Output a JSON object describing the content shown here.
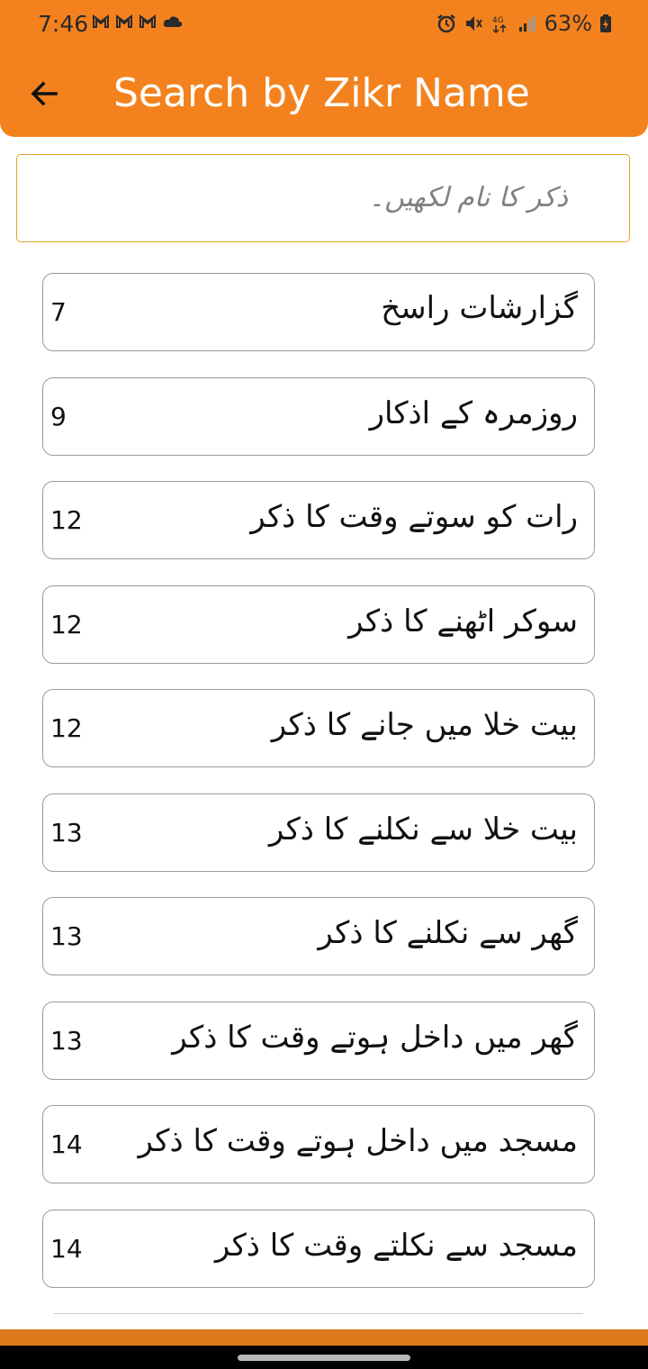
{
  "status": {
    "time": "7:46",
    "battery": "63%",
    "icons": [
      "gmail-icon",
      "gmail-icon",
      "gmail-icon",
      "cloud-icon",
      "alarm-icon",
      "vibrate-icon",
      "4g-icon",
      "signal-icon",
      "battery-icon"
    ]
  },
  "header": {
    "title": "Search by Zikr Name",
    "background_color": "#F3821E"
  },
  "search": {
    "placeholder": "ذکر کا نام لکھیں۔",
    "value": ""
  },
  "items": [
    {
      "title": "گزارشات راسخ",
      "page": "7"
    },
    {
      "title": "روزمرہ کے اذکار",
      "page": "9"
    },
    {
      "title": "رات کو سوتے وقت کا ذکر",
      "page": "12"
    },
    {
      "title": "سوکر اٹھنے کا ذکر",
      "page": "12"
    },
    {
      "title": "بیت خلا میں جانے کا ذکر",
      "page": "12"
    },
    {
      "title": "بیت خلا سے نکلنے کا ذکر",
      "page": "13"
    },
    {
      "title": "گھر سے نکلنے کا ذکر",
      "page": "13"
    },
    {
      "title": "گھر میں داخل ہوتے وقت کا ذکر",
      "page": "13"
    },
    {
      "title": "مسجد میں داخل ہوتے وقت کا ذکر",
      "page": "14"
    },
    {
      "title": "مسجد سے نکلتے وقت کا ذکر",
      "page": "14"
    }
  ]
}
